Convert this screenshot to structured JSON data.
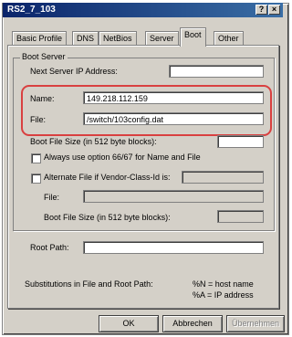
{
  "window": {
    "title": "RS2_7_103"
  },
  "titlebar": {
    "help_label": "?",
    "close_label": "×"
  },
  "tabs": [
    {
      "label": "Basic Profile"
    },
    {
      "label": "DNS"
    },
    {
      "label": "NetBios"
    },
    {
      "label": "Server"
    },
    {
      "label": "Boot"
    },
    {
      "label": "Other"
    }
  ],
  "boot_server": {
    "group_label": "Boot Server",
    "next_server_label": "Next Server IP Address:",
    "next_server_value": "",
    "name_label": "Name:",
    "name_value": "149.218.112.159",
    "file_label": "File:",
    "file_value": "/switch/103config.dat",
    "boot_file_size_label": "Boot File Size (in 512 byte blocks):",
    "boot_file_size_value": "",
    "option_66_67_label": "Always use option 66/67 for Name and File",
    "alternate_file_label": "Alternate File if Vendor-Class-Id is:",
    "alternate_vendor_value": "",
    "alt_file_label": "File:",
    "alt_file_value": "",
    "alt_boot_file_size_label": "Boot File Size (in 512 byte blocks):",
    "alt_boot_file_size_value": ""
  },
  "root_path": {
    "label": "Root Path:",
    "value": ""
  },
  "substitutions": {
    "label": "Substitutions in File and Root Path:",
    "line1": "%N = host name",
    "line2": "%A = IP address"
  },
  "buttons": {
    "ok": "OK",
    "cancel": "Abbrechen",
    "apply": "Übernehmen"
  }
}
